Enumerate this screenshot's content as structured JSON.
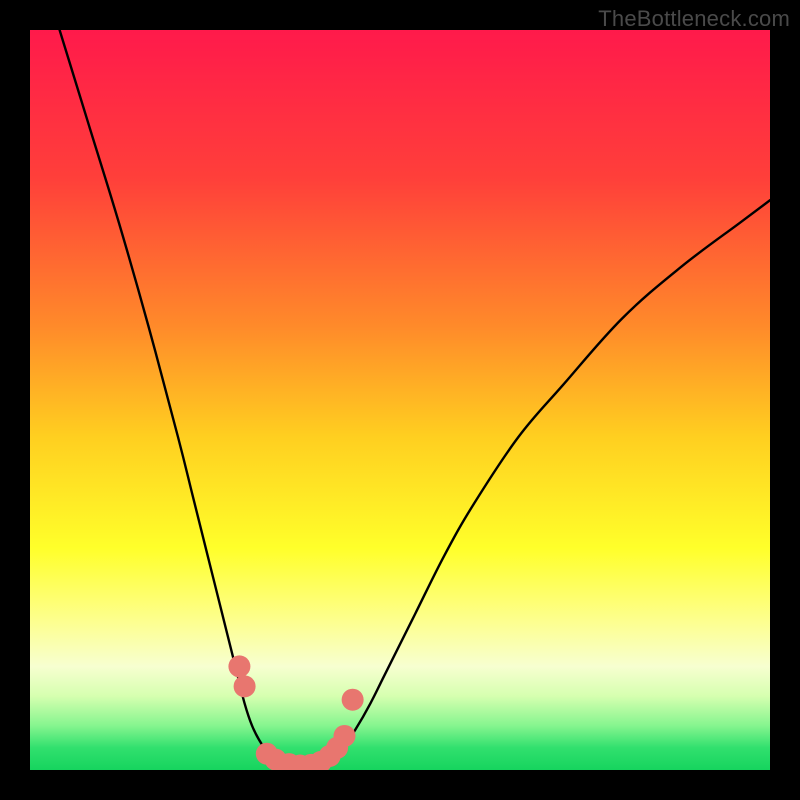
{
  "watermark": "TheBottleneck.com",
  "chart_data": {
    "type": "line",
    "title": "",
    "xlabel": "",
    "ylabel": "",
    "xlim": [
      0,
      100
    ],
    "ylim": [
      0,
      100
    ],
    "gradient_stops": [
      {
        "offset": 0.0,
        "color": "#ff1a4b"
      },
      {
        "offset": 0.2,
        "color": "#ff3f3a"
      },
      {
        "offset": 0.4,
        "color": "#ff8a2a"
      },
      {
        "offset": 0.55,
        "color": "#ffcf20"
      },
      {
        "offset": 0.7,
        "color": "#ffff2a"
      },
      {
        "offset": 0.8,
        "color": "#fdff90"
      },
      {
        "offset": 0.86,
        "color": "#f7ffd0"
      },
      {
        "offset": 0.9,
        "color": "#d6ffb0"
      },
      {
        "offset": 0.94,
        "color": "#86f58f"
      },
      {
        "offset": 0.97,
        "color": "#31e06e"
      },
      {
        "offset": 1.0,
        "color": "#16d45e"
      }
    ],
    "series": [
      {
        "name": "left-arm",
        "x": [
          4,
          8,
          12,
          16,
          20,
          22,
          24,
          26,
          28,
          29,
          30,
          31,
          32,
          33,
          34,
          35
        ],
        "y": [
          100,
          87,
          74,
          60,
          45,
          37,
          29,
          21,
          13,
          9,
          6,
          4,
          2.5,
          1.5,
          1,
          0.7
        ]
      },
      {
        "name": "right-arm",
        "x": [
          40,
          41,
          42,
          44,
          46,
          48,
          52,
          56,
          60,
          66,
          72,
          80,
          88,
          96,
          100
        ],
        "y": [
          0.7,
          1.2,
          2.5,
          5.5,
          9,
          13,
          21,
          29,
          36,
          45,
          52,
          61,
          68,
          74,
          77
        ]
      },
      {
        "name": "valley-floor",
        "x": [
          35,
          36,
          37,
          38,
          39,
          40
        ],
        "y": [
          0.7,
          0.5,
          0.4,
          0.4,
          0.5,
          0.7
        ]
      }
    ],
    "markers": {
      "name": "highlight-points",
      "color": "#e8766f",
      "radius": 11,
      "points": [
        {
          "x": 28.3,
          "y": 14.0
        },
        {
          "x": 29.0,
          "y": 11.3
        },
        {
          "x": 32.0,
          "y": 2.2
        },
        {
          "x": 33.2,
          "y": 1.4
        },
        {
          "x": 35.0,
          "y": 0.8
        },
        {
          "x": 36.5,
          "y": 0.6
        },
        {
          "x": 38.0,
          "y": 0.7
        },
        {
          "x": 39.3,
          "y": 1.1
        },
        {
          "x": 40.5,
          "y": 1.9
        },
        {
          "x": 41.5,
          "y": 3.0
        },
        {
          "x": 42.5,
          "y": 4.6
        },
        {
          "x": 43.6,
          "y": 9.5
        }
      ]
    }
  }
}
